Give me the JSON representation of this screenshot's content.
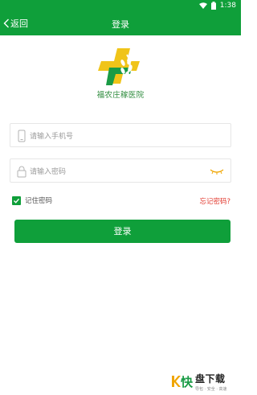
{
  "status_bar": {
    "time": "1:38"
  },
  "nav": {
    "back_label": "返回",
    "title": "登录"
  },
  "logo": {
    "name": "福农庄稼医院"
  },
  "form": {
    "phone_placeholder": "请输入手机号",
    "password_placeholder": "请输入密码",
    "remember_label": "记住密码",
    "remember_checked": true,
    "forgot_label": "忘记密码?",
    "login_label": "登录"
  },
  "watermark": {
    "brand_char": "快",
    "brand_text": "盘下载",
    "tagline": "导包 · 安全 · 高速"
  },
  "colors": {
    "primary": "#0f9f3a",
    "forgot": "#e23a2f",
    "placeholder": "#9a9a9a"
  }
}
